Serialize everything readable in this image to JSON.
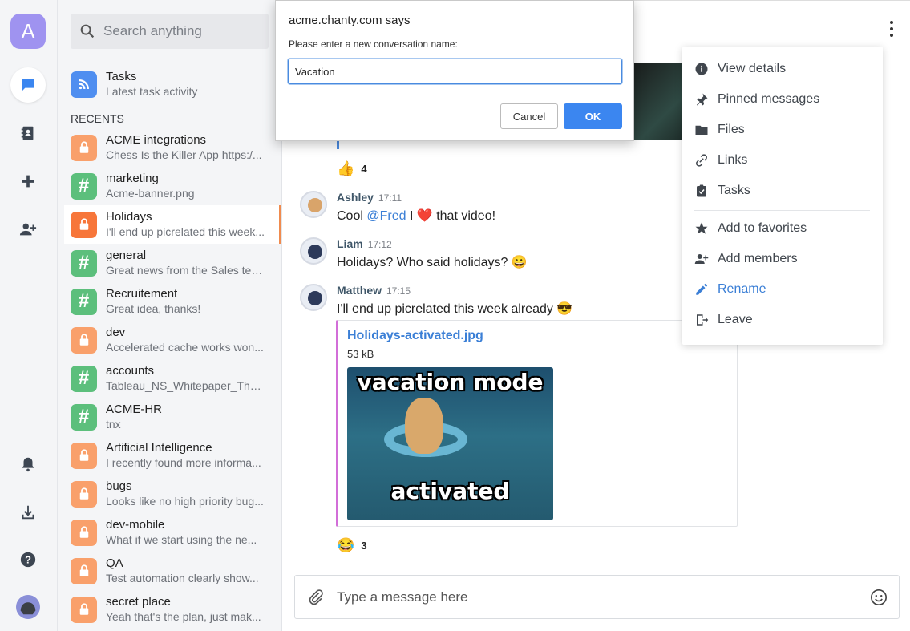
{
  "rail": {
    "avatar_letter": "A",
    "accent": "#9f93f0"
  },
  "search": {
    "placeholder": "Search anything"
  },
  "tasks": {
    "name": "Tasks",
    "preview": "Latest task activity"
  },
  "recents_label": "RECENTS",
  "conversations": [
    {
      "name": "ACME integrations",
      "preview": "Chess Is the Killer App https:/...",
      "icon": "lock-icon",
      "color": "#f9a06b"
    },
    {
      "name": "marketing",
      "preview": "Acme-banner.png",
      "icon": "hash-icon",
      "color": "#5cbf7c"
    },
    {
      "name": "Holidays",
      "preview": "I'll end up picrelated this week...",
      "icon": "lock-icon",
      "color": "#f7763a"
    },
    {
      "name": "general",
      "preview": "Great news from the Sales tea...",
      "icon": "hash-icon",
      "color": "#5cbf7c"
    },
    {
      "name": "Recruitement",
      "preview": "Great idea, thanks!",
      "icon": "hash-icon",
      "color": "#5cbf7c"
    },
    {
      "name": "dev",
      "preview": "Accelerated cache works won...",
      "icon": "lock-icon",
      "color": "#f9a06b"
    },
    {
      "name": "accounts",
      "preview": "Tableau_NS_Whitepaper_The_...",
      "icon": "hash-icon",
      "color": "#5cbf7c"
    },
    {
      "name": "ACME-HR",
      "preview": "tnx",
      "icon": "hash-icon",
      "color": "#5cbf7c"
    },
    {
      "name": "Artificial Intelligence",
      "preview": "I recently found more informa...",
      "icon": "lock-icon",
      "color": "#f9a06b"
    },
    {
      "name": "bugs",
      "preview": "Looks like no high priority bug...",
      "icon": "lock-icon",
      "color": "#f9a06b"
    },
    {
      "name": "dev-mobile",
      "preview": "What if we start using the ne...",
      "icon": "lock-icon",
      "color": "#f9a06b"
    },
    {
      "name": "QA",
      "preview": "Test automation clearly show...",
      "icon": "lock-icon",
      "color": "#f9a06b"
    },
    {
      "name": "secret place",
      "preview": "Yeah that's the plan, just mak...",
      "icon": "lock-icon",
      "color": "#f9a06b"
    }
  ],
  "reactions": {
    "thumbs": {
      "emoji": "👍",
      "count": "4"
    },
    "laugh": {
      "emoji": "😂",
      "count": "3"
    }
  },
  "messages": [
    {
      "author": "Ashley",
      "time": "17:11",
      "text_before": "Cool ",
      "mention": "@Fred",
      "text_after": " I ",
      "emoji": "❤️",
      "text_end": " that video!"
    },
    {
      "author": "Liam",
      "time": "17:12",
      "text": "Holidays? Who said holidays? ",
      "emoji": "😀"
    },
    {
      "author": "Matthew",
      "time": "17:15",
      "text": "I'll end up picrelated this week already ",
      "emoji": "😎"
    }
  ],
  "attachment": {
    "filename": "Holidays-activated.jpg",
    "size": "53 kB",
    "caption_top": "vacation mode",
    "caption_bottom": "activated"
  },
  "composer": {
    "placeholder": "Type a message here"
  },
  "menu": {
    "items": [
      {
        "label": "View details",
        "icon": "info-icon"
      },
      {
        "label": "Pinned messages",
        "icon": "pin-icon"
      },
      {
        "label": "Files",
        "icon": "folder-icon"
      },
      {
        "label": "Links",
        "icon": "link-icon"
      },
      {
        "label": "Tasks",
        "icon": "clipboard-icon"
      },
      {
        "label": "Add to favorites",
        "icon": "star-icon"
      },
      {
        "label": "Add members",
        "icon": "add-user-icon"
      },
      {
        "label": "Rename",
        "icon": "pencil-icon"
      },
      {
        "label": "Leave",
        "icon": "exit-icon"
      }
    ],
    "accent": "#3b7fd6"
  },
  "dialog": {
    "title": "acme.chanty.com says",
    "message": "Please enter a new conversation name:",
    "input_value": "Vacation",
    "cancel_label": "Cancel",
    "ok_label": "OK",
    "ok_color": "#3b86f0"
  }
}
